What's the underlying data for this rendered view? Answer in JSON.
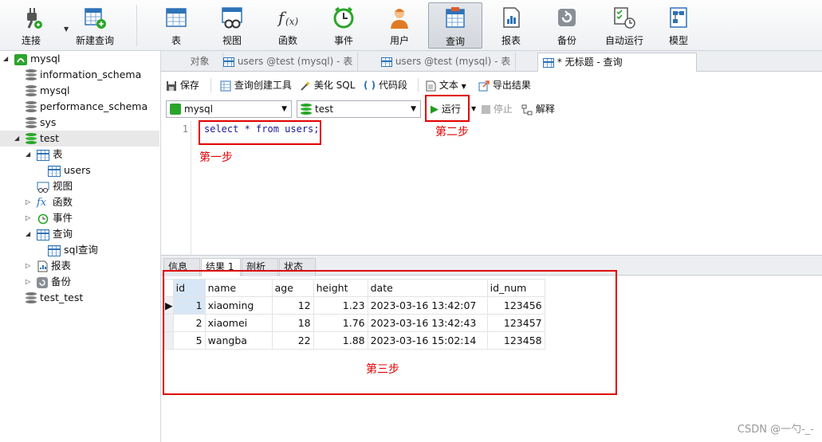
{
  "toolbar": {
    "connect": "连接",
    "new_query": "新建查询",
    "table": "表",
    "view": "视图",
    "function": "函数",
    "event": "事件",
    "user": "用户",
    "query": "查询",
    "report": "报表",
    "backup": "备份",
    "auto_run": "自动运行",
    "model": "模型"
  },
  "tree": {
    "items": [
      {
        "label": "mysql"
      },
      {
        "label": "information_schema"
      },
      {
        "label": "mysql"
      },
      {
        "label": "performance_schema"
      },
      {
        "label": "sys"
      },
      {
        "label": "test"
      },
      {
        "label": "表"
      },
      {
        "label": "users"
      },
      {
        "label": "视图"
      },
      {
        "label": "函数"
      },
      {
        "label": "事件"
      },
      {
        "label": "查询"
      },
      {
        "label": "sql查询"
      },
      {
        "label": "报表"
      },
      {
        "label": "备份"
      },
      {
        "label": "test_test"
      }
    ]
  },
  "tabs": [
    {
      "label": "对象"
    },
    {
      "label": "users @test (mysql) - 表"
    },
    {
      "label": "users @test (mysql) - 表"
    },
    {
      "label": "* 无标题 - 查询"
    }
  ],
  "editor_toolbar": {
    "save": "保存",
    "query_builder": "查询创建工具",
    "beautify": "美化 SQL",
    "snippet": "代码段",
    "text": "文本",
    "export": "导出结果",
    "connection": "mysql",
    "database": "test",
    "run": "运行",
    "stop": "停止",
    "explain": "解释"
  },
  "editor": {
    "line_number": "1",
    "sql": "select * from users;"
  },
  "annotations": {
    "step1": "第一步",
    "step2": "第二步",
    "step3": "第三步"
  },
  "result_tabs": [
    {
      "label": "信息"
    },
    {
      "label": "结果 1"
    },
    {
      "label": "剖析"
    },
    {
      "label": "状态"
    }
  ],
  "result": {
    "columns": [
      "id",
      "name",
      "age",
      "height",
      "date",
      "id_num"
    ],
    "rows": [
      [
        "1",
        "xiaoming",
        "12",
        "1.23",
        "2023-03-16 13:42:07",
        "123456"
      ],
      [
        "2",
        "xiaomei",
        "18",
        "1.76",
        "2023-03-16 13:42:43",
        "123457"
      ],
      [
        "5",
        "wangba",
        "22",
        "1.88",
        "2023-03-16 15:02:14",
        "123458"
      ]
    ]
  },
  "footer": "CSDN @一勺-_-",
  "colors": {
    "accent_red": "#e00000",
    "db_green": "#2aa52a",
    "run_green": "#1f9b1f"
  }
}
